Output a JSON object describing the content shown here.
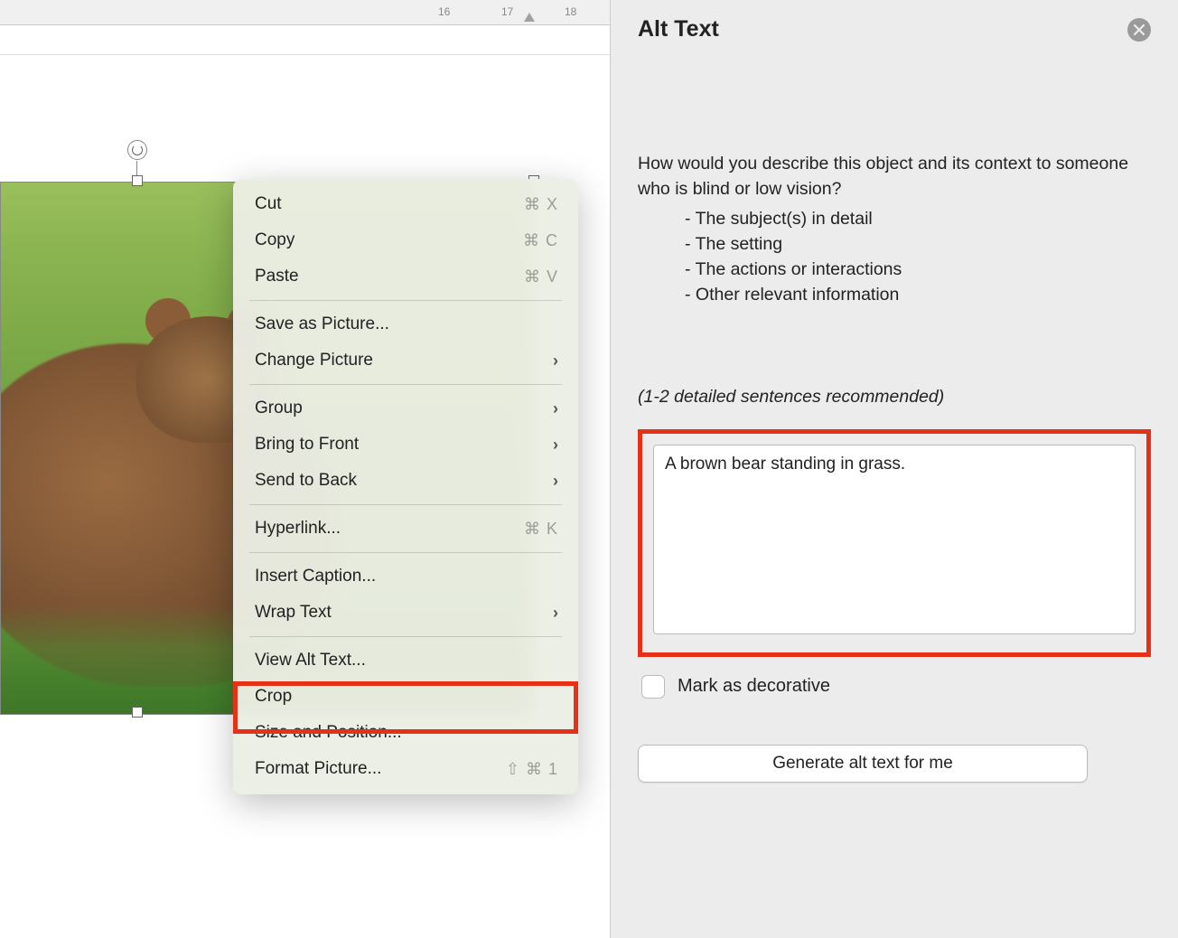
{
  "ruler": {
    "visibleNumbers": [
      "16",
      "17",
      "18"
    ]
  },
  "contextMenu": {
    "groups": [
      [
        {
          "label": "Cut",
          "shortcut": "⌘ X"
        },
        {
          "label": "Copy",
          "shortcut": "⌘ C"
        },
        {
          "label": "Paste",
          "shortcut": "⌘ V"
        }
      ],
      [
        {
          "label": "Save as Picture..."
        },
        {
          "label": "Change Picture",
          "submenu": true
        }
      ],
      [
        {
          "label": "Group",
          "submenu": true
        },
        {
          "label": "Bring to Front",
          "submenu": true
        },
        {
          "label": "Send to Back",
          "submenu": true
        }
      ],
      [
        {
          "label": "Hyperlink...",
          "shortcut": "⌘ K"
        }
      ],
      [
        {
          "label": "Insert Caption..."
        },
        {
          "label": "Wrap Text",
          "submenu": true
        }
      ],
      [
        {
          "label": "View Alt Text...",
          "highlighted": true
        },
        {
          "label": "Crop"
        },
        {
          "label": "Size and Position..."
        },
        {
          "label": "Format Picture...",
          "shortcut": "⇧ ⌘ 1"
        }
      ]
    ]
  },
  "panel": {
    "title": "Alt Text",
    "prompt": "How would you describe this object and its context to someone who is blind or low vision?",
    "bullets": [
      "The subject(s) in detail",
      "The setting",
      "The actions or interactions",
      "Other relevant information"
    ],
    "hint": "(1-2 detailed sentences recommended)",
    "altValue": "A brown bear standing in grass.",
    "decorativeLabel": "Mark as decorative",
    "generateLabel": "Generate alt text for me"
  }
}
